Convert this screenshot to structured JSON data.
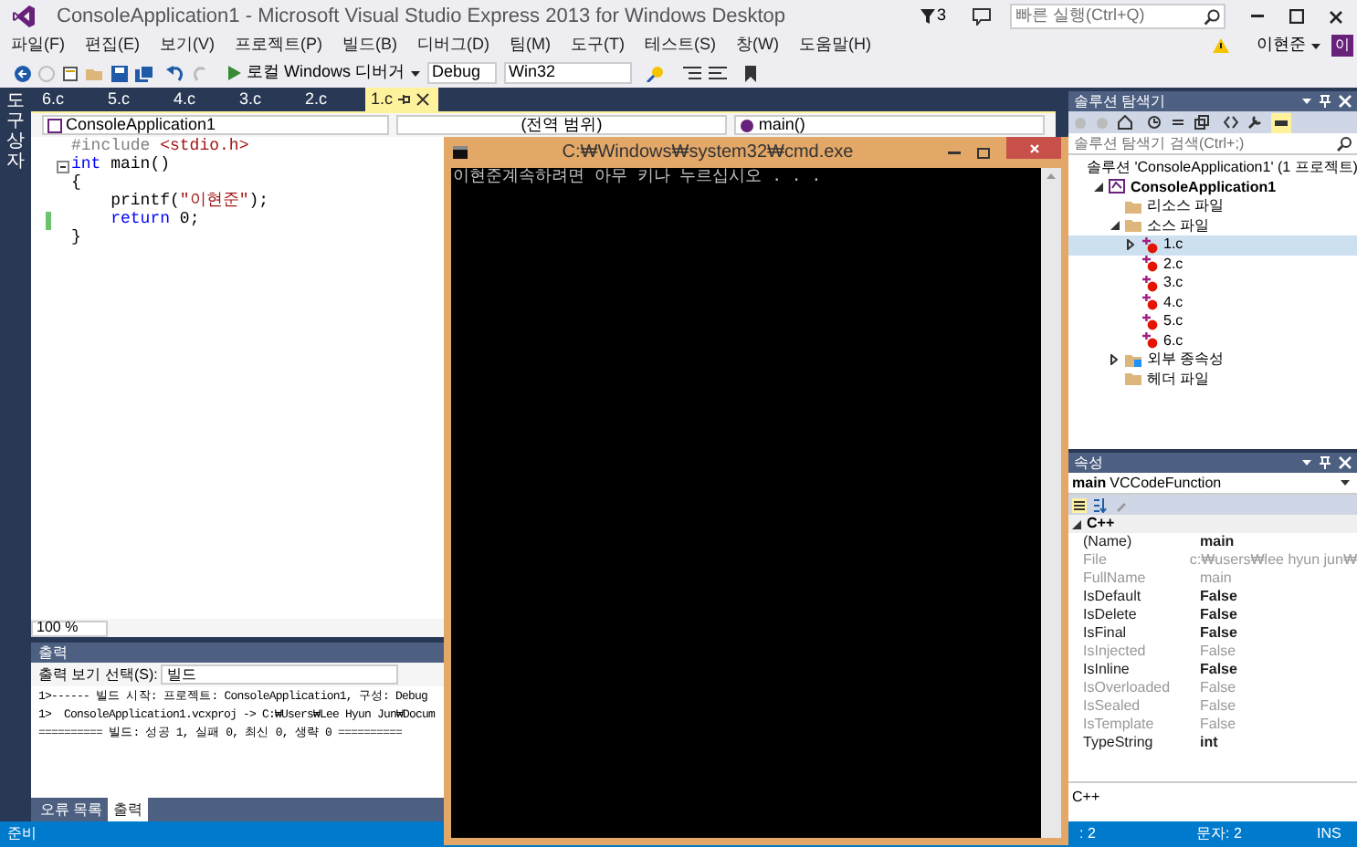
{
  "window": {
    "title": "ConsoleApplication1 - Microsoft Visual Studio Express 2013 for Windows Desktop",
    "notifications": "3",
    "quick_launch": {
      "placeholder": "빠른 실행(Ctrl+Q)"
    },
    "user": "이현준",
    "avatar": "이"
  },
  "menu": [
    "파일(F)",
    "편집(E)",
    "보기(V)",
    "프로젝트(P)",
    "빌드(B)",
    "디버그(D)",
    "팀(M)",
    "도구(T)",
    "테스트(S)",
    "창(W)",
    "도움말(H)"
  ],
  "toolbar": {
    "debugger": "로컬 Windows 디버거",
    "configuration": "Debug",
    "platform": "Win32"
  },
  "toolbox_tab": "도구 상자",
  "editor": {
    "tabs": [
      {
        "label": "6.c",
        "selected": false
      },
      {
        "label": "5.c",
        "selected": false
      },
      {
        "label": "4.c",
        "selected": false
      },
      {
        "label": "3.c",
        "selected": false
      },
      {
        "label": "2.c",
        "selected": false
      },
      {
        "label": "1.c",
        "selected": true
      }
    ],
    "nav": [
      "ConsoleApplication1",
      "(전역 범위)",
      "main()"
    ],
    "lines": [
      {
        "kind": "plain",
        "tokens": [
          {
            "text": "#include ",
            "kind": "preproc"
          },
          {
            "text": "<stdio.h>",
            "kind": "string"
          }
        ]
      },
      {
        "kind": "fold_start",
        "tokens": [
          {
            "text": "int",
            "kind": "keyword"
          },
          {
            "text": " main()",
            "kind": "plain"
          }
        ]
      },
      {
        "kind": "plain",
        "tokens": [
          {
            "text": "{",
            "kind": "plain"
          }
        ]
      },
      {
        "kind": "plain",
        "tokens": [
          {
            "text": "    printf(",
            "kind": "plain"
          },
          {
            "text": "\"이현준\"",
            "kind": "string"
          },
          {
            "text": ");",
            "kind": "plain"
          }
        ]
      },
      {
        "kind": "changed",
        "tokens": [
          {
            "text": "    return",
            "kind": "keyword"
          },
          {
            "text": " 0;",
            "kind": "plain"
          }
        ]
      },
      {
        "kind": "plain",
        "tokens": [
          {
            "text": "}",
            "kind": "plain"
          }
        ]
      }
    ],
    "zoom": "100 %"
  },
  "output": {
    "title": "출력",
    "source_label": "출력 보기 선택(S):",
    "source": "빌드",
    "lines": [
      "1>------ 빌드 시작: 프로젝트: ConsoleApplication1, 구성: Debug",
      "1>  ConsoleApplication1.vcxproj -> C:₩Users₩Lee Hyun Jun₩Docum",
      "========== 빌드: 성공 1, 실패 0, 최신 0, 생략 0 =========="
    ],
    "tabs": [
      {
        "label": "오류 목록",
        "selected": false
      },
      {
        "label": "출력",
        "selected": true
      }
    ]
  },
  "solution_explorer": {
    "title": "솔루션 탐색기",
    "search": {
      "placeholder": "솔루션 탐색기 검색(Ctrl+;)"
    },
    "tree": [
      {
        "label": "솔루션 'ConsoleApplication1' (1 프로젝트)",
        "kind": "solution",
        "selected": false,
        "children": [
          {
            "label": "ConsoleApplication1",
            "kind": "project",
            "selected": false,
            "expanded": true,
            "children": [
              {
                "label": "리소스 파일",
                "kind": "folder",
                "selected": false
              },
              {
                "label": "소스 파일",
                "kind": "folder",
                "selected": false,
                "expanded": true,
                "children": [
                  {
                    "label": "1.c",
                    "kind": "file",
                    "selected": true,
                    "expanded": false
                  },
                  {
                    "label": "2.c",
                    "kind": "file",
                    "selected": false
                  },
                  {
                    "label": "3.c",
                    "kind": "file",
                    "selected": false
                  },
                  {
                    "label": "4.c",
                    "kind": "file",
                    "selected": false
                  },
                  {
                    "label": "5.c",
                    "kind": "file",
                    "selected": false
                  },
                  {
                    "label": "6.c",
                    "kind": "file",
                    "selected": false
                  }
                ]
              },
              {
                "label": "외부 종속성",
                "kind": "dependencies",
                "selected": false,
                "expanded": false
              },
              {
                "label": "헤더 파일",
                "kind": "folder",
                "selected": false
              }
            ]
          }
        ]
      }
    ]
  },
  "properties": {
    "title": "속성",
    "object": "main",
    "object_type": "VCCodeFunction",
    "category": "C++",
    "rows": [
      {
        "name": "(Name)",
        "value": "main",
        "disabled": false
      },
      {
        "name": "File",
        "value": "c:₩users₩lee hyun jun₩",
        "disabled": true
      },
      {
        "name": "FullName",
        "value": "main",
        "disabled": true
      },
      {
        "name": "IsDefault",
        "value": "False",
        "disabled": false
      },
      {
        "name": "IsDelete",
        "value": "False",
        "disabled": false
      },
      {
        "name": "IsFinal",
        "value": "False",
        "disabled": false
      },
      {
        "name": "IsInjected",
        "value": "False",
        "disabled": true
      },
      {
        "name": "IsInline",
        "value": "False",
        "disabled": false
      },
      {
        "name": "IsOverloaded",
        "value": "False",
        "disabled": true
      },
      {
        "name": "IsSealed",
        "value": "False",
        "disabled": true
      },
      {
        "name": "IsTemplate",
        "value": "False",
        "disabled": true
      },
      {
        "name": "TypeString",
        "value": "int",
        "disabled": false
      }
    ],
    "description": "C++"
  },
  "console": {
    "title": "C:₩Windows₩system32₩cmd.exe",
    "lines": [
      "이현준계속하려면 아무 키나 누르십시오 . . ."
    ]
  },
  "status_bar": {
    "ready": "준비",
    "line": ": 2",
    "column": "문자: 2",
    "mode": "INS"
  }
}
